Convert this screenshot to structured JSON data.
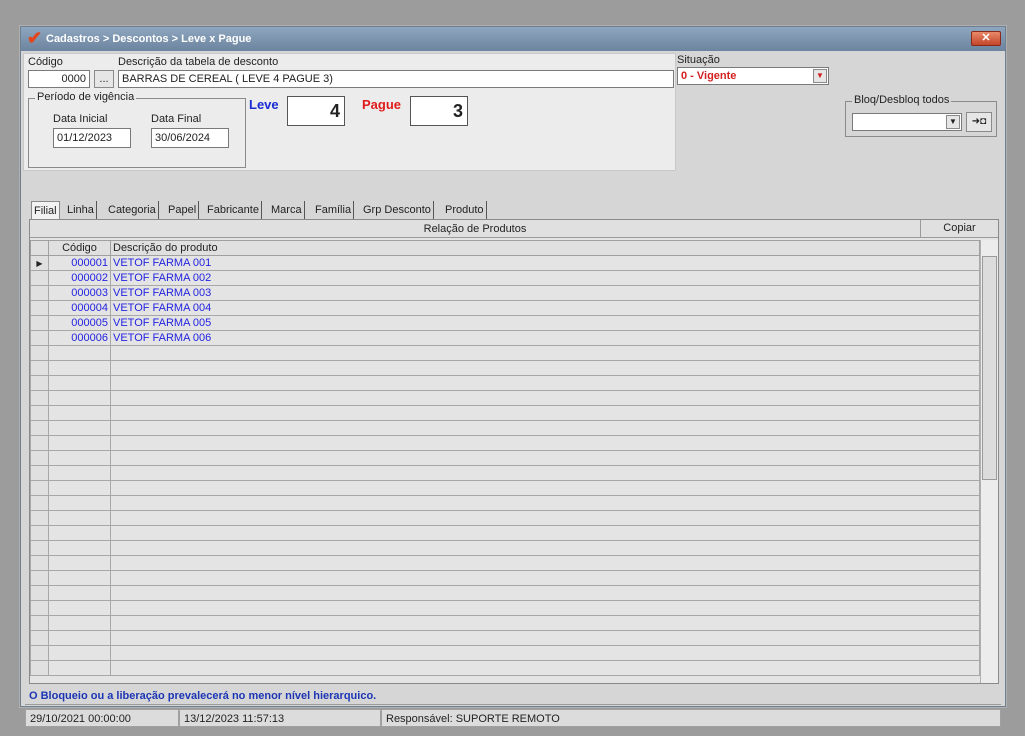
{
  "window": {
    "title": "Cadastros > Descontos > Leve x Pague",
    "close_label": "✕"
  },
  "header": {
    "codigo_label": "Código",
    "codigo_value": "0000",
    "lookup_label": "...",
    "descricao_label": "Descrição da tabela de desconto",
    "descricao_value": "BARRAS DE CEREAL ( LEVE 4 PAGUE 3)",
    "periodo_label": "Período de vigência",
    "data_inicial_label": "Data Inicial",
    "data_inicial_value": "01/12/2023",
    "data_final_label": "Data Final",
    "data_final_value": "30/06/2024",
    "leve_label": "Leve",
    "leve_value": "4",
    "pague_label": "Pague",
    "pague_value": "3",
    "situacao_label": "Situação",
    "situacao_value": "0 - Vigente",
    "bloq_label": "Bloq/Desbloq todos",
    "bloq_value": "",
    "bloq_button": "➜◘"
  },
  "colors": {
    "leve": "#1a2bd6",
    "pague": "#e01b1b",
    "situacao": "#d42020",
    "info": "#1c35b5"
  },
  "tabs": [
    {
      "label": "Filial"
    },
    {
      "label": "Linha"
    },
    {
      "label": "Categoria"
    },
    {
      "label": "Papel"
    },
    {
      "label": "Fabricante"
    },
    {
      "label": "Marca"
    },
    {
      "label": "Família"
    },
    {
      "label": "Grp Desconto"
    },
    {
      "label": "Produto"
    }
  ],
  "grid": {
    "caption": "Relação de Produtos",
    "copy_label": "Copiar",
    "col_codigo": "Código",
    "col_descricao": "Descrição do produto",
    "rows": [
      {
        "codigo": "000001",
        "descricao": "VETOF FARMA 001"
      },
      {
        "codigo": "000002",
        "descricao": "VETOF FARMA 002"
      },
      {
        "codigo": "000003",
        "descricao": "VETOF FARMA 003"
      },
      {
        "codigo": "000004",
        "descricao": "VETOF FARMA 004"
      },
      {
        "codigo": "000005",
        "descricao": "VETOF FARMA 005"
      },
      {
        "codigo": "000006",
        "descricao": "VETOF FARMA 006"
      }
    ]
  },
  "info_text": "O Bloqueio ou a liberação prevalecerá no menor nível hierarquico.",
  "status": {
    "created": "29/10/2021 00:00:00",
    "updated": "13/12/2023 11:57:13",
    "responsavel": "Responsável: SUPORTE REMOTO"
  }
}
